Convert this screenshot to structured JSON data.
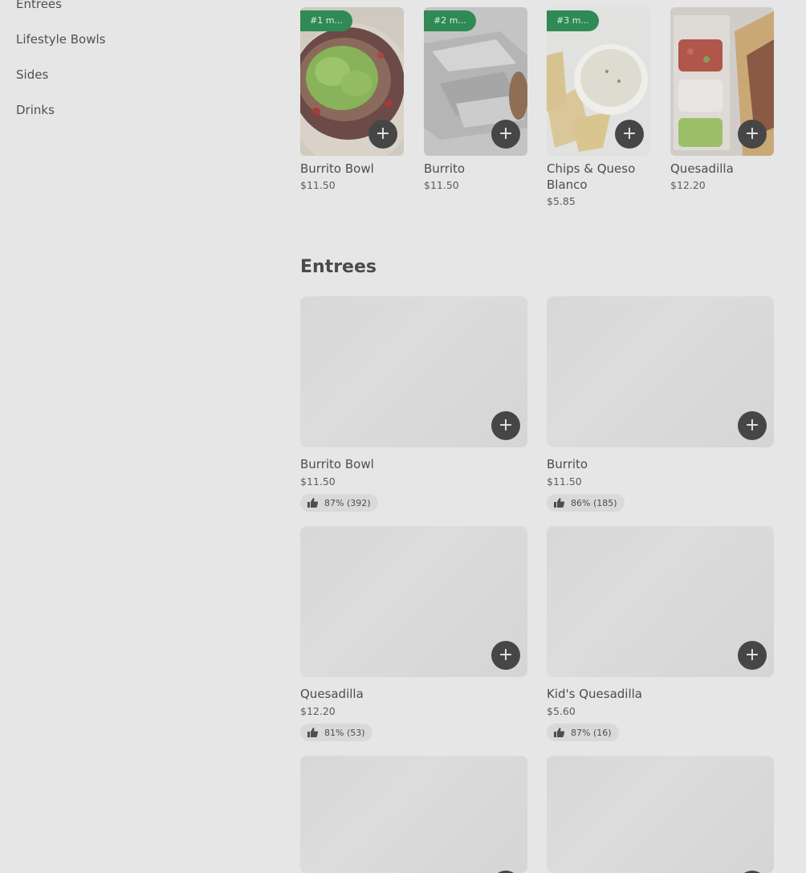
{
  "sidebar": {
    "items": [
      {
        "label": "Entrees"
      },
      {
        "label": "Lifestyle Bowls"
      },
      {
        "label": "Sides"
      },
      {
        "label": "Drinks"
      }
    ]
  },
  "popular": [
    {
      "badge": "#1 m...",
      "name": "Burrito Bowl",
      "price": "$11.50"
    },
    {
      "badge": "#2 m...",
      "name": "Burrito",
      "price": "$11.50"
    },
    {
      "badge": "#3 m...",
      "name": "Chips & Queso Blanco",
      "price": "$5.85"
    },
    {
      "badge": "",
      "name": "Quesadilla",
      "price": "$12.20"
    }
  ],
  "entrees_section": {
    "title": "Entrees",
    "items": [
      {
        "name": "Burrito Bowl",
        "price": "$11.50",
        "rating": "87% (392)"
      },
      {
        "name": "Burrito",
        "price": "$11.50",
        "rating": "86% (185)"
      },
      {
        "name": "Quesadilla",
        "price": "$12.20",
        "rating": "81% (53)"
      },
      {
        "name": "Kid's Quesadilla",
        "price": "$5.60",
        "rating": "87% (16)"
      },
      {
        "name": "",
        "price": "",
        "rating": ""
      },
      {
        "name": "",
        "price": "",
        "rating": ""
      }
    ]
  },
  "icons": {
    "add": "plus-icon",
    "rating": "thumbs-up-icon"
  },
  "colors": {
    "badge": "#2f8a55",
    "button": "#464646",
    "background": "#e6e6e6"
  }
}
